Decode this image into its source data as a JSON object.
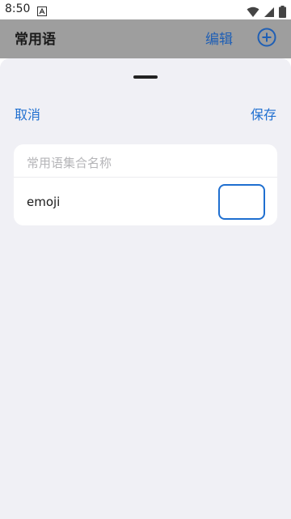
{
  "statusbar": {
    "time": "8:50",
    "icons": [
      "notification-a-icon",
      "wifi-icon",
      "signal-icon",
      "battery-icon"
    ]
  },
  "background_header": {
    "title": "常用语",
    "edit_label": "编辑",
    "add_icon": "plus-circle-icon"
  },
  "sheet": {
    "cancel_label": "取消",
    "save_label": "保存",
    "collection_name_placeholder": "常用语集合名称",
    "emoji_label": "emoji",
    "emoji_value": ""
  },
  "colors": {
    "accent": "#1f6fd0",
    "sheet_background": "#f0f0f5",
    "dimmed_header": "#9e9e9e"
  }
}
